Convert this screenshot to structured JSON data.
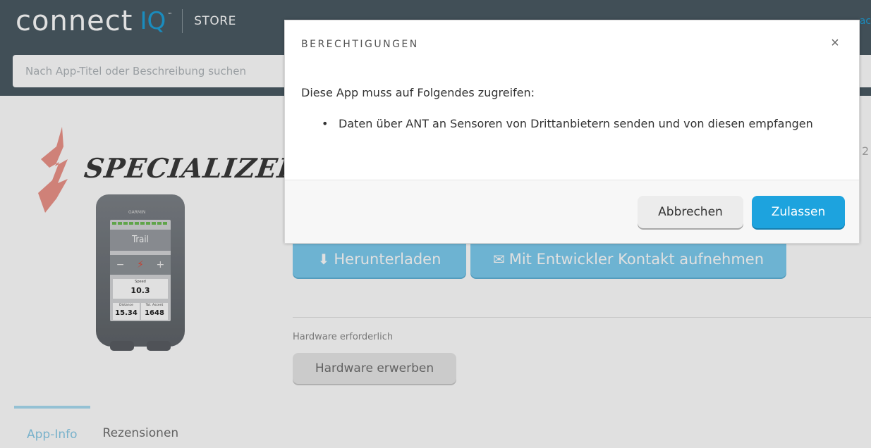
{
  "header": {
    "logo_connect": "connect",
    "logo_iq": "IQ",
    "logo_tm": "™",
    "store_label": "STORE",
    "edge_link": "ac"
  },
  "search": {
    "placeholder": "Nach App-Titel oder Beschreibung suchen"
  },
  "app": {
    "brand_name": "SPECIALIZED",
    "device": {
      "brand": "GARMIN",
      "screen_title": "Trail",
      "minus": "−",
      "plus": "+",
      "speed_label": "Speed",
      "speed_value": "10.3",
      "distance_label": "Distance",
      "distance_value": "15.34",
      "ascent_label": "Tot. Ascent",
      "ascent_value": "1648"
    },
    "download_label": "Herunterladen",
    "contact_label": "Mit Entwickler Kontakt aufnehmen",
    "hardware_label": "Hardware erforderlich",
    "hardware_button": "Hardware erwerben",
    "edge_digit": "2"
  },
  "tabs": [
    {
      "label": "App-Info",
      "active": true
    },
    {
      "label": "Rezensionen",
      "active": false
    }
  ],
  "modal": {
    "title": "BERECHTIGUNGEN",
    "close": "×",
    "intro": "Diese App muss auf Folgendes zugreifen:",
    "permissions": [
      "Daten über ANT an Sensoren von Drittanbietern senden und von diesen empfangen"
    ],
    "cancel_label": "Abbrechen",
    "allow_label": "Zulassen"
  },
  "colors": {
    "header_bg": "#4a5a63",
    "accent": "#1da3de",
    "disabled_button": "#7dccef"
  }
}
